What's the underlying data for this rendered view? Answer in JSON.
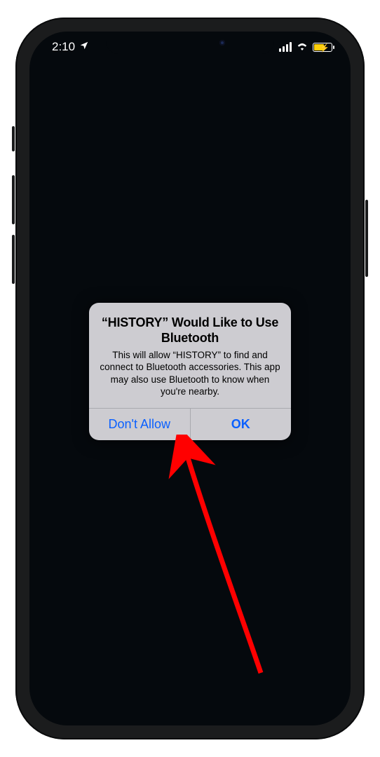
{
  "status": {
    "time": "2:10",
    "location_icon": "location-arrow",
    "cellular_bars": 4,
    "wifi_bars": 3,
    "battery_state": "charging-low-power"
  },
  "alert": {
    "title": "“HISTORY” Would Like to Use Bluetooth",
    "message": "This will allow “HISTORY” to find and connect to Bluetooth accessories. This app may also use Bluetooth to know when you're nearby.",
    "deny_label": "Don't Allow",
    "allow_label": "OK"
  },
  "colors": {
    "ios_blue": "#0a60ff",
    "alert_bg": "#cdccd1",
    "battery_fill": "#ffcf0a",
    "annotation_red": "#ff0000"
  }
}
